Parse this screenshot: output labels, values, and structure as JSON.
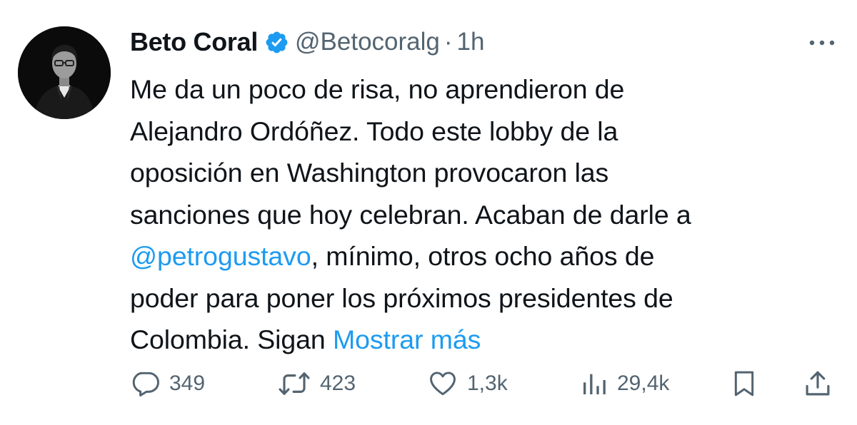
{
  "author": {
    "display_name": "Beto Coral",
    "handle": "@Betocoralg",
    "separator": "·",
    "time": "1h",
    "verified_color": "#1d9bf0"
  },
  "tweet": {
    "lines": [
      "Me da un poco de risa, no aprendieron de",
      "Alejandro Ordóñez. Todo este lobby de la",
      "oposición en Washington provocaron las",
      "sanciones que hoy celebran. Acaban de darle a"
    ],
    "mention": "@petrogustavo",
    "mention_rest": ", mínimo, otros ocho años de",
    "line7": "poder para poner los próximos presidentes de",
    "line8_text": "Colombia. Sigan ",
    "show_more": "Mostrar más",
    "link_color": "#1d9bf0"
  },
  "actions": {
    "replies": "349",
    "retweets": "423",
    "likes": "1,3k",
    "views": "29,4k",
    "icons": [
      "reply-icon",
      "retweet-icon",
      "like-icon",
      "views-icon",
      "bookmark-icon",
      "share-icon"
    ]
  }
}
